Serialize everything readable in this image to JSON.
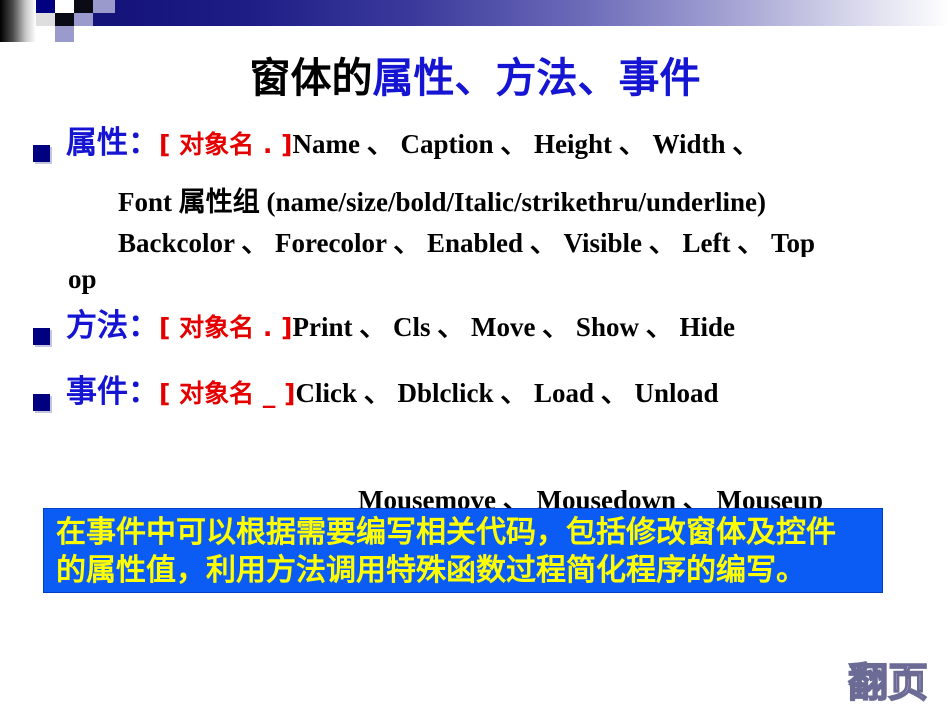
{
  "slide": {
    "title": {
      "part_black": "窗体的",
      "part_blue": "属性、方法、事件"
    },
    "bullets": [
      {
        "label": "属性：",
        "object_ref": "[ 对象名 . ]",
        "members": "Name 、  Caption 、  Height 、  Width 、",
        "continuation_lines": [
          "Font 属性组 (name/size/bold/Italic/strikethru/underline)",
          "Backcolor 、  Forecolor 、  Enabled 、  Visible 、  Left 、   Top",
          "op"
        ]
      },
      {
        "label": "方法：",
        "object_ref": "[ 对象名 . ]",
        "members": "Print 、  Cls 、  Move 、  Show 、  Hide",
        "continuation_lines": []
      },
      {
        "label": "事件：",
        "object_ref": "[ 对象名 _ ]",
        "members": "Click 、  Dblclick 、  Load 、   Unload",
        "continuation_lines": [
          "Mousemove 、  Mousedown 、  Mouseup"
        ]
      }
    ],
    "callout": {
      "line1": "在事件中可以根据需要编写相关代码，包括修改窗体及控件",
      "line2": "的属性值，利用方法调用特殊函数过程简化程序的编写。",
      "background_color": "#0b5cf5",
      "text_color": "#ffff00"
    },
    "page_turn_label": "翻页",
    "colors": {
      "title_black": "#000000",
      "title_blue": "#1414d2",
      "bullet_label_blue": "#1414d2",
      "object_ref_red": "#e50000",
      "bullet_marker": "#000080",
      "banner_navy": "#14137a",
      "page_turn_outline": "#6b6b96"
    }
  }
}
